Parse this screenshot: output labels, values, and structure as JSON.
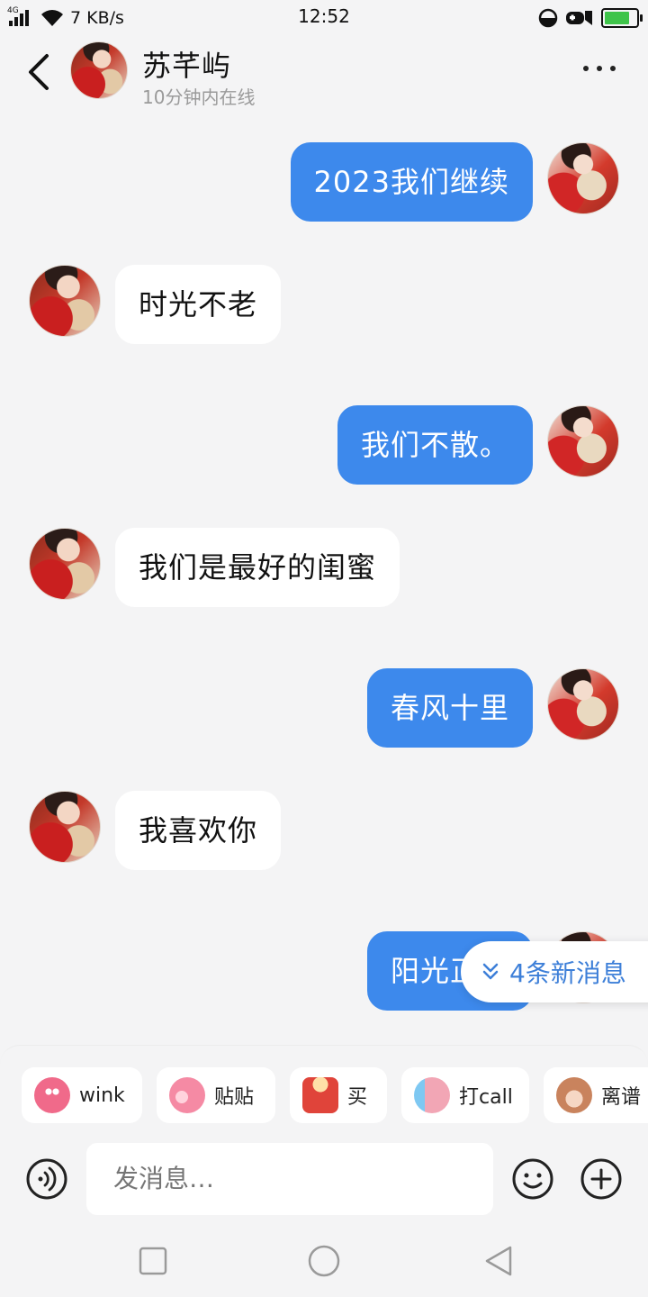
{
  "status_bar": {
    "network": "4G",
    "speed": "7 KB/s",
    "time": "12:52"
  },
  "header": {
    "contact_name": "苏芊屿",
    "contact_status": "10分钟内在线"
  },
  "messages": [
    {
      "side": "out",
      "text": "2023我们继续"
    },
    {
      "side": "in",
      "text": "时光不老"
    },
    {
      "side": "out",
      "text": "我们不散。"
    },
    {
      "side": "in",
      "text": "我们是最好的闺蜜"
    },
    {
      "side": "out",
      "text": "春风十里"
    },
    {
      "side": "in",
      "text": "我喜欢你"
    },
    {
      "side": "out",
      "text": "阳光正好"
    }
  ],
  "new_messages_pill": "4条新消息",
  "stickers": [
    {
      "label": "wink",
      "icon": "pink-bunny-sticker-icon",
      "color": "#f06a8a"
    },
    {
      "label": "贴贴",
      "icon": "pink-hug-sticker-icon",
      "color": "#f58aa4"
    },
    {
      "label": "买",
      "icon": "buy-sign-sticker-icon",
      "color": "#e0443a"
    },
    {
      "label": "打call",
      "icon": "glowstick-sticker-icon",
      "color": "#f2a6b5"
    },
    {
      "label": "离谱",
      "icon": "shocked-face-sticker-icon",
      "color": "#c9835d"
    }
  ],
  "input": {
    "placeholder": "发消息…"
  },
  "colors": {
    "outgoing_bubble": "#3d89ec",
    "incoming_bubble": "#ffffff",
    "background": "#f4f4f5",
    "accent": "#3d7fd8"
  }
}
